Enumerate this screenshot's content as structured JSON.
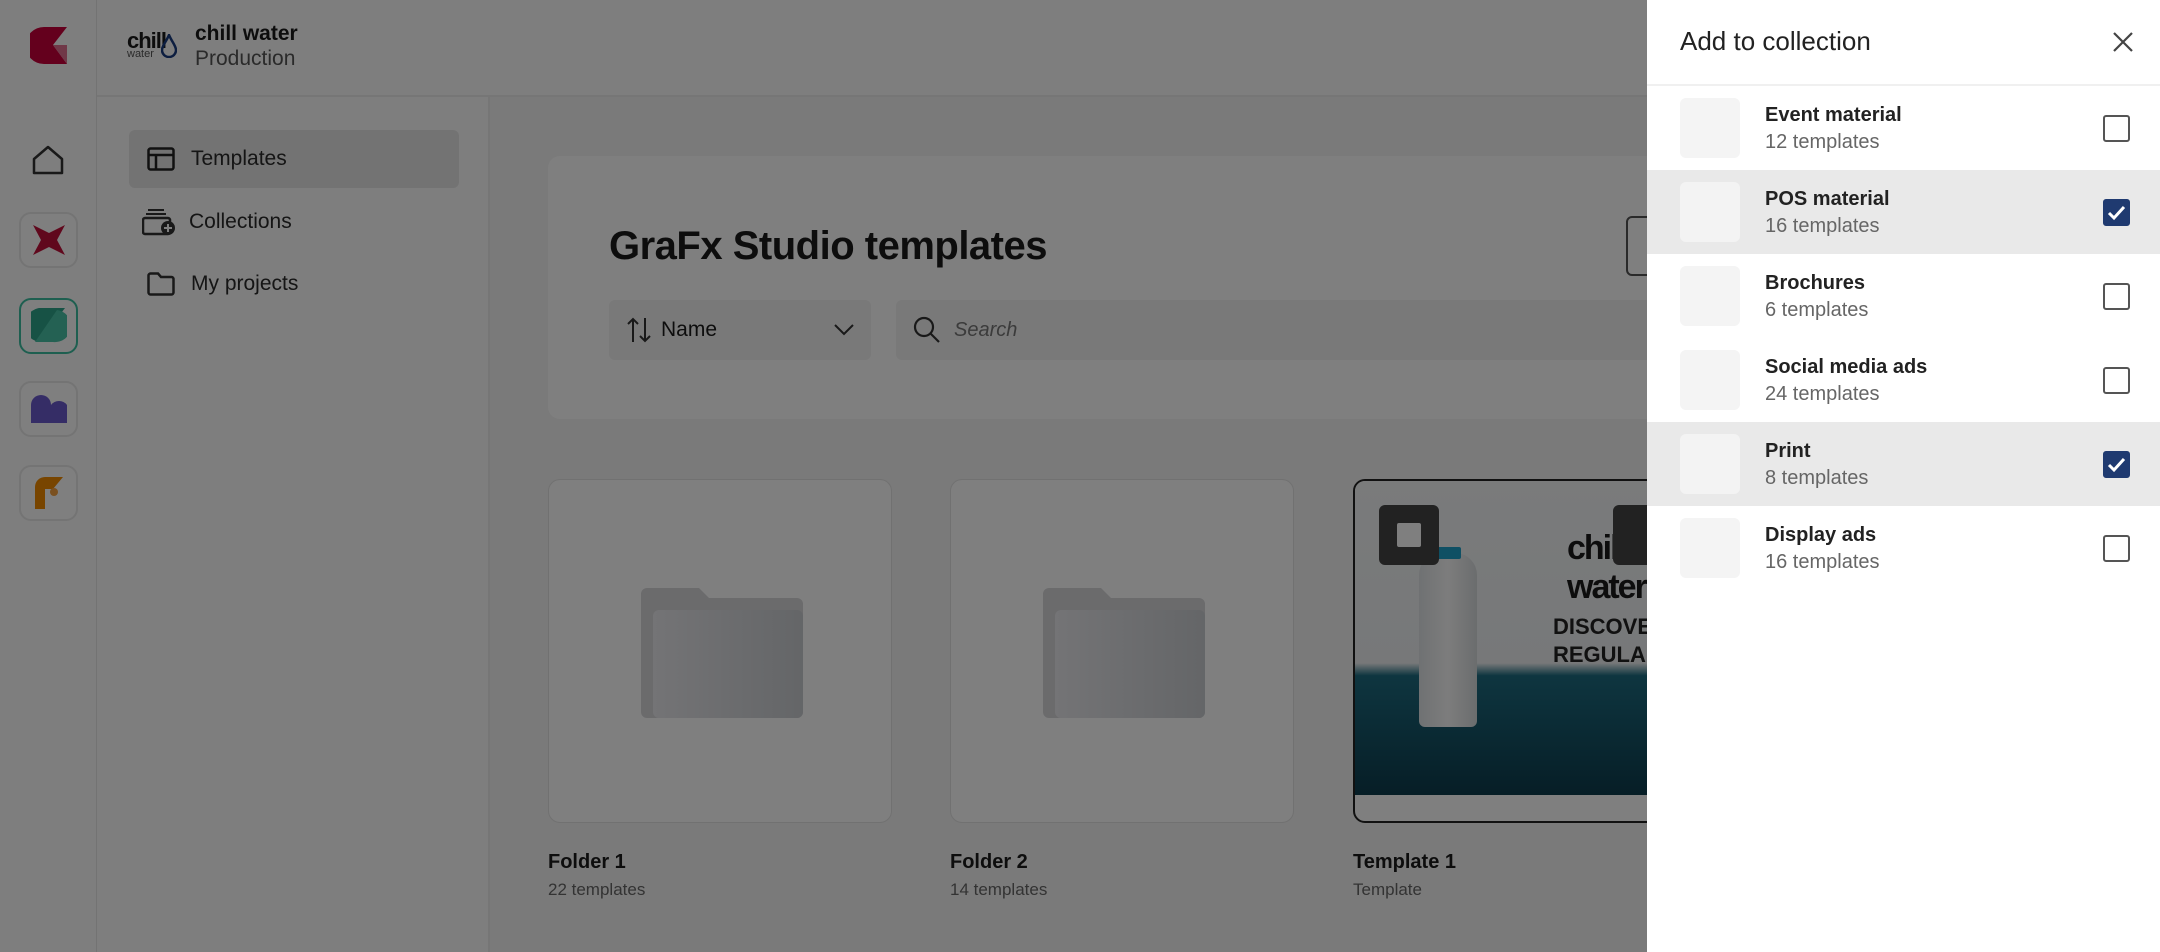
{
  "header": {
    "brand_logo_text": "chill water",
    "org_name": "chill water",
    "environment": "Production"
  },
  "rail": {
    "apps": [
      "home-icon",
      "app-red-star-icon",
      "app-teal-s-icon",
      "app-purple-m-icon",
      "app-orange-f-icon"
    ],
    "active_app": "app-teal-s-icon"
  },
  "sidebar": {
    "items": [
      {
        "label": "Templates",
        "icon": "template-icon",
        "active": true
      },
      {
        "label": "Collections",
        "icon": "collections-add-icon"
      },
      {
        "label": "My projects",
        "icon": "folder-icon"
      }
    ]
  },
  "main": {
    "title": "GraFx Studio templates",
    "sort": {
      "label": "Name"
    },
    "search": {
      "placeholder": "Search"
    },
    "cards": [
      {
        "name": "Folder 1",
        "sub": "22 templates",
        "type": "folder"
      },
      {
        "name": "Folder 2",
        "sub": "14 templates",
        "type": "folder"
      },
      {
        "name": "Template 1",
        "sub": "Template",
        "type": "template",
        "preview_text": [
          "DISCOVER",
          "REGULAR"
        ],
        "preview_logo": "chill water"
      }
    ]
  },
  "panel": {
    "title": "Add to collection",
    "accent": "#1f3a70",
    "collections": [
      {
        "name": "Event material",
        "count": "12 templates",
        "checked": false
      },
      {
        "name": "POS material",
        "count": "16 templates",
        "checked": true
      },
      {
        "name": "Brochures",
        "count": "6 templates",
        "checked": false
      },
      {
        "name": "Social media ads",
        "count": "24 templates",
        "checked": false
      },
      {
        "name": "Print",
        "count": "8 templates",
        "checked": true
      },
      {
        "name": "Display ads",
        "count": "16 templates",
        "checked": false
      }
    ]
  }
}
